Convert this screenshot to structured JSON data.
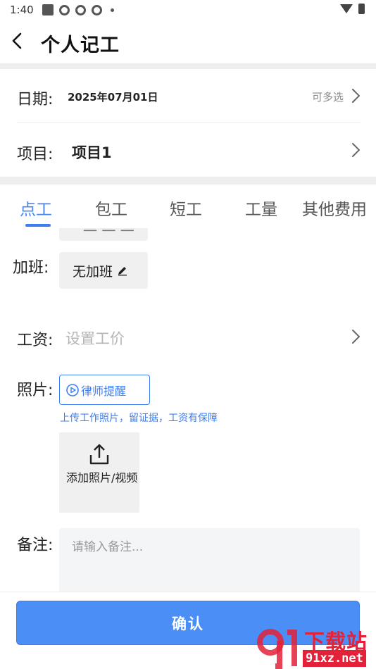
{
  "status_bar": {
    "time": "1:40"
  },
  "header": {
    "title": "个人记工"
  },
  "date_row": {
    "label": "日期:",
    "value": "2025年07月01日",
    "hint": "可多选"
  },
  "project_row": {
    "label": "项目:",
    "value": "项目1"
  },
  "tabs": [
    {
      "label": "点工",
      "active": true
    },
    {
      "label": "包工",
      "active": false
    },
    {
      "label": "短工",
      "active": false
    },
    {
      "label": "工量",
      "active": false
    },
    {
      "label": "其他费用",
      "active": false
    }
  ],
  "overtime": {
    "label": "加班:",
    "value": "无加班"
  },
  "wage": {
    "label": "工资:",
    "placeholder": "设置工价"
  },
  "photo": {
    "label": "照片:",
    "lawyer_button": "律师提醒",
    "hint": "上传工作照片，留证据，工资有保障",
    "add_label": "添加照片/视频"
  },
  "remark": {
    "label": "备注:",
    "placeholder": "请输入备注..."
  },
  "confirm": {
    "label": "确认"
  },
  "watermark": {
    "title": "下载站",
    "url": "91xz.net"
  },
  "colors": {
    "accent": "#3d7ef2",
    "confirm": "#4b8ef5",
    "watermark": "#e3223a"
  }
}
